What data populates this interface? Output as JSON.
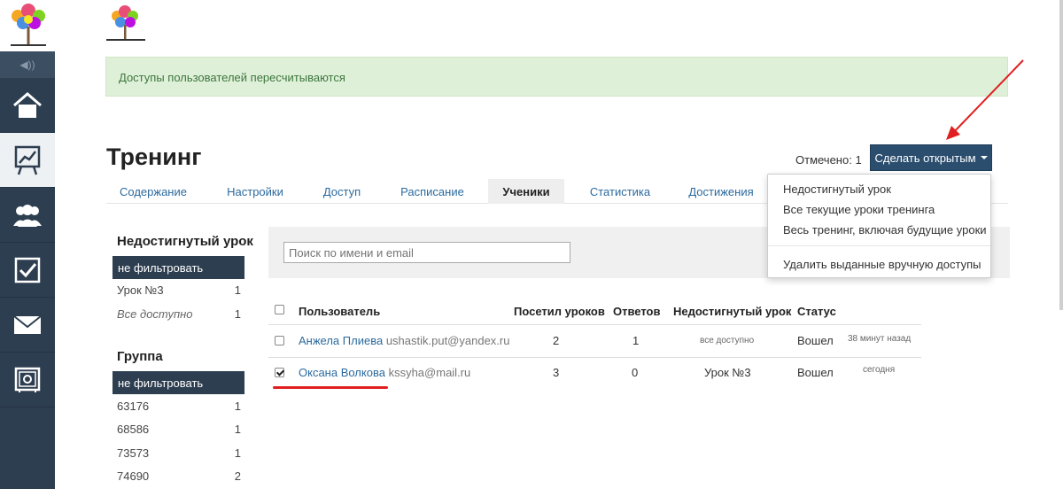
{
  "sidebar": {
    "items": [
      {
        "icon": "home-icon"
      },
      {
        "icon": "chart-board-icon"
      },
      {
        "icon": "users-icon"
      },
      {
        "icon": "checkbox-icon"
      },
      {
        "icon": "mail-icon"
      },
      {
        "icon": "safe-icon"
      }
    ]
  },
  "alert": {
    "text": "Доступы пользователей пересчитываются"
  },
  "header": {
    "title": "Тренинг",
    "marked_label": "Отмечено: 1",
    "open_button": "Сделать открытым"
  },
  "tabs": [
    "Содержание",
    "Настройки",
    "Доступ",
    "Расписание",
    "Ученики",
    "Статистика",
    "Достижения"
  ],
  "active_tab": "Ученики",
  "dropdown": {
    "items": [
      "Недостигнутый урок",
      "Все текущие уроки тренинга",
      "Весь тренинг, включая будущие уроки"
    ],
    "extra": "Удалить выданные вручную доступы"
  },
  "filters": {
    "lesson": {
      "title": "Недостигнутый урок",
      "active": "не фильтровать",
      "rows": [
        {
          "label": "Урок №3",
          "count": "1"
        },
        {
          "label": "Все доступно",
          "count": "1"
        }
      ]
    },
    "group": {
      "title": "Группа",
      "active": "не фильтровать",
      "rows": [
        {
          "label": "63176",
          "count": "1"
        },
        {
          "label": "68586",
          "count": "1"
        },
        {
          "label": "73573",
          "count": "1"
        },
        {
          "label": "74690",
          "count": "2"
        }
      ]
    }
  },
  "search": {
    "placeholder": "Поиск по имени и email"
  },
  "table": {
    "headers": [
      "Пользователь",
      "Посетил уроков",
      "Ответов",
      "Недостигнутый урок",
      "Статус"
    ],
    "rows": [
      {
        "name": "Анжела Плиева",
        "email": "ushastik.put@yandex.ru",
        "visited": "2",
        "answers": "1",
        "lesson": "все доступно",
        "status": "Вошел",
        "time": "38 минут назад",
        "checked": false
      },
      {
        "name": "Оксана Волкова",
        "email": "kssyha@mail.ru",
        "visited": "3",
        "answers": "0",
        "lesson": "Урок №3",
        "status": "Вошел",
        "time": "сегодня",
        "checked": true
      }
    ]
  },
  "colors": {
    "sidebar": "#2d3e50",
    "accent": "#2b4e6e",
    "link": "#2b6a9e",
    "alert_bg": "#dff0d8",
    "annotation": "#e02020"
  }
}
